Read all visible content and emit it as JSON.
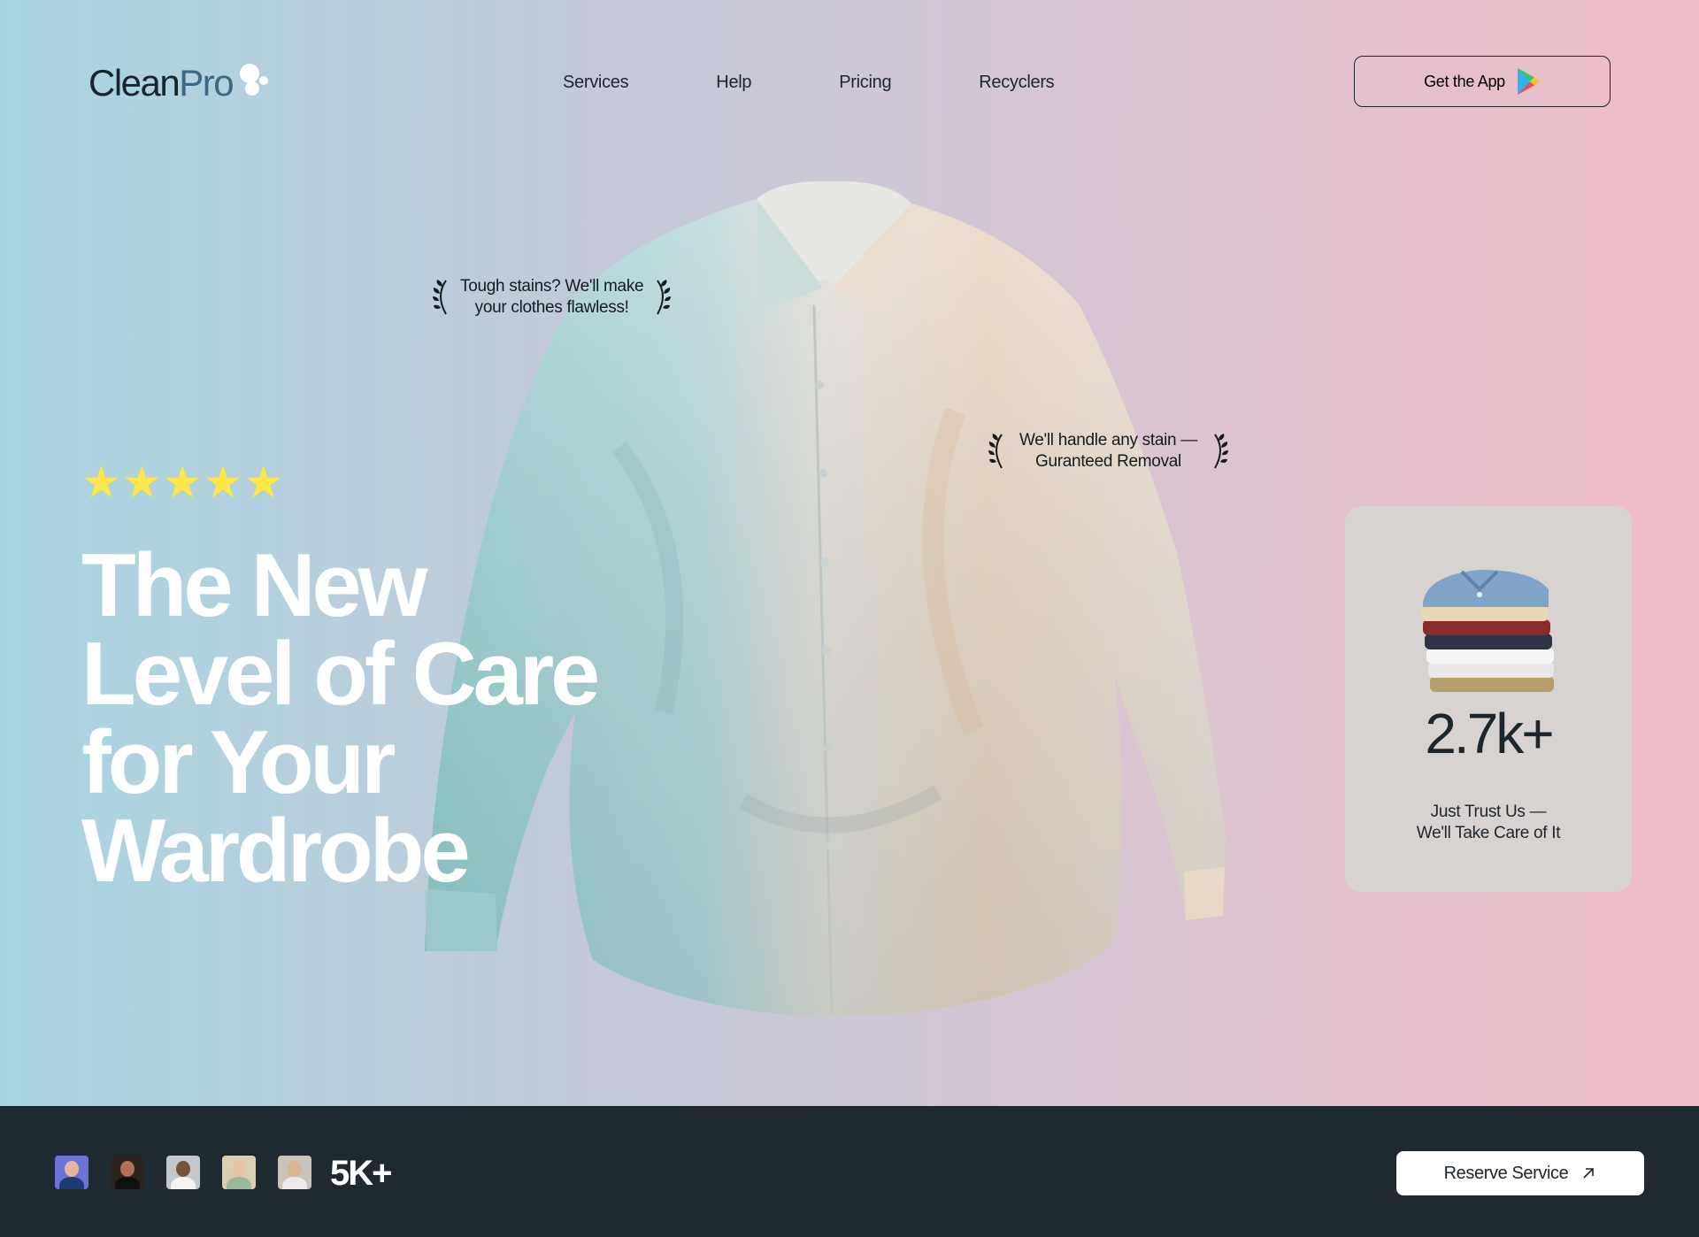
{
  "header": {
    "logo_main": "Clean",
    "logo_accent": "Pro",
    "nav": [
      {
        "label": "Services"
      },
      {
        "label": "Help"
      },
      {
        "label": "Pricing"
      },
      {
        "label": "Recyclers"
      }
    ],
    "app_button": {
      "label": "Get the App",
      "icon": "google-play-icon"
    }
  },
  "hero": {
    "rating_stars": 5,
    "headline_lines": [
      "The New",
      "Level of Care",
      "for Your",
      "Wardrobe"
    ],
    "callouts": [
      {
        "line1": "Tough stains? We'll make",
        "line2": "your clothes flawless!"
      },
      {
        "line1": "We'll handle any stain —",
        "line2": "Guranteed Removal"
      }
    ]
  },
  "stats_card": {
    "value": "2.7k+",
    "caption_line1": "Just Trust Us —",
    "caption_line2": "We'll Take Care of It"
  },
  "footer": {
    "customer_count": "5K+",
    "reserve_button": {
      "label": "Reserve Service",
      "icon": "arrow-up-right-icon"
    }
  },
  "colors": {
    "gradient_left": "#a9d5e1",
    "gradient_right": "#efbdc6",
    "footer_bg": "#1e2a30",
    "star": "#fde74a",
    "card_bg": "#d8d2d1"
  }
}
